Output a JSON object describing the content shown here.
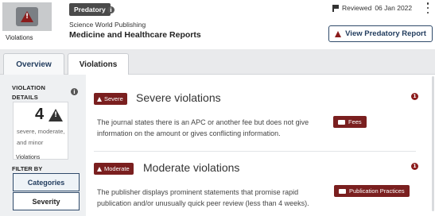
{
  "header": {
    "thumbnail_label": "Violations",
    "status_badge": "Predatory",
    "publisher": "Science World Publishing",
    "journal_title": "Medicine and Healthcare Reports",
    "reviewed_label": "Reviewed",
    "reviewed_date": "06 Jan 2022",
    "report_button": "View Predatory Report"
  },
  "tabs": [
    {
      "label": "Overview",
      "active": false
    },
    {
      "label": "Violations",
      "active": true
    }
  ],
  "sidebar": {
    "section_label": "VIOLATION DETAILS",
    "count": "4",
    "count_desc": "severe, moderate, and minor",
    "count_caption": "Violations",
    "filter_label": "FILTER BY",
    "filters": [
      "Categories",
      "Severity"
    ]
  },
  "sections": [
    {
      "badge": "Severe",
      "title": "Severe violations",
      "count": "1",
      "bullet": "The journal states there is an APC or another fee but does not give information on the amount or gives conflicting information.",
      "bullet_line1": "The journal states there is an APC or another fee but does not give",
      "bullet_line2": "information on the amount or gives conflicting information.",
      "tag": "Fees"
    },
    {
      "badge": "Moderate",
      "title": "Moderate violations",
      "count": "1",
      "bullet_line1": "The publisher displays prominent statements that promise rapid",
      "bullet_line2": "publication and/or unusually quick peer review (less than 4 weeks).",
      "tag": "Publication Practices"
    }
  ],
  "colors": {
    "severe": "#7a1f1f",
    "navy": "#1f3a5c",
    "panel_bg": "#eef0f2"
  }
}
